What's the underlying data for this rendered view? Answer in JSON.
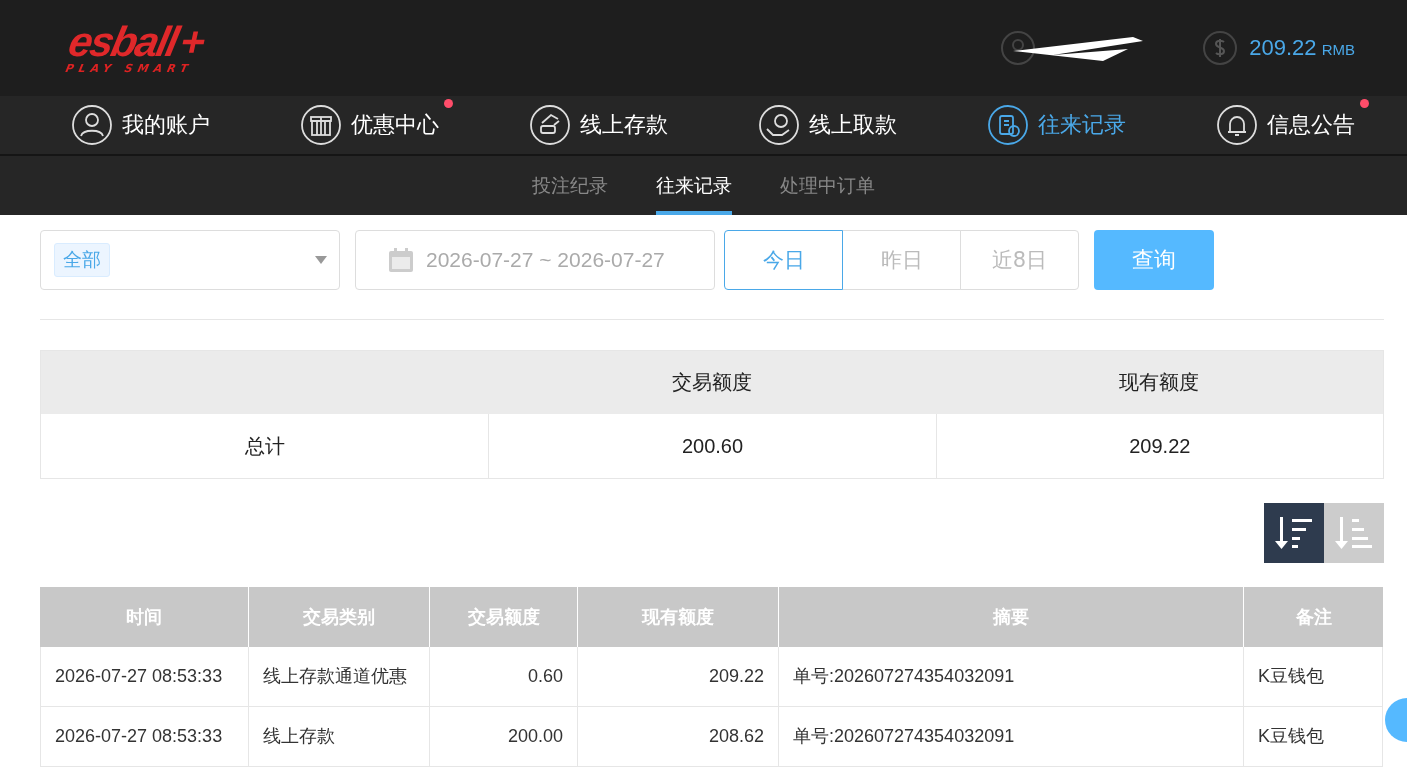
{
  "header": {
    "logo": {
      "brand": "esball",
      "mark": "+",
      "tagline": "PLAY SMART"
    },
    "balance": {
      "amount": "209.22",
      "currency": "RMB"
    }
  },
  "nav": [
    {
      "label": "我的账户",
      "selected": false,
      "dot": false
    },
    {
      "label": "优惠中心",
      "selected": false,
      "dot": true
    },
    {
      "label": "线上存款",
      "selected": false,
      "dot": false
    },
    {
      "label": "线上取款",
      "selected": false,
      "dot": false
    },
    {
      "label": "往来记录",
      "selected": true,
      "dot": false
    },
    {
      "label": "信息公告",
      "selected": false,
      "dot": true
    }
  ],
  "subtabs": [
    {
      "label": "投注纪录",
      "selected": false
    },
    {
      "label": "往来记录",
      "selected": true
    },
    {
      "label": "处理中订单",
      "selected": false
    }
  ],
  "filters": {
    "category": "全部",
    "date_range": "2026-07-27 ~ 2026-07-27",
    "quick_ranges": [
      {
        "label": "今日",
        "selected": true
      },
      {
        "label": "昨日",
        "selected": false
      },
      {
        "label": "近8日",
        "selected": false
      }
    ],
    "query_button": "查询"
  },
  "summary": {
    "columns": [
      "交易额度",
      "现有额度"
    ],
    "row": [
      "总计",
      "200.60",
      "209.22"
    ]
  },
  "sort_buttons": [
    {
      "selected": true
    },
    {
      "selected": false
    }
  ],
  "table": {
    "columns": [
      "时间",
      "交易类别",
      "交易额度",
      "现有额度",
      "摘要",
      "备注"
    ],
    "rows": [
      [
        "2026-07-27 08:53:33",
        "线上存款通道优惠",
        "0.60",
        "209.22",
        "单号:202607274354032091",
        "K豆钱包"
      ],
      [
        "2026-07-27 08:53:33",
        "线上存款",
        "200.00",
        "208.62",
        "单号:202607274354032091",
        "K豆钱包"
      ]
    ]
  }
}
